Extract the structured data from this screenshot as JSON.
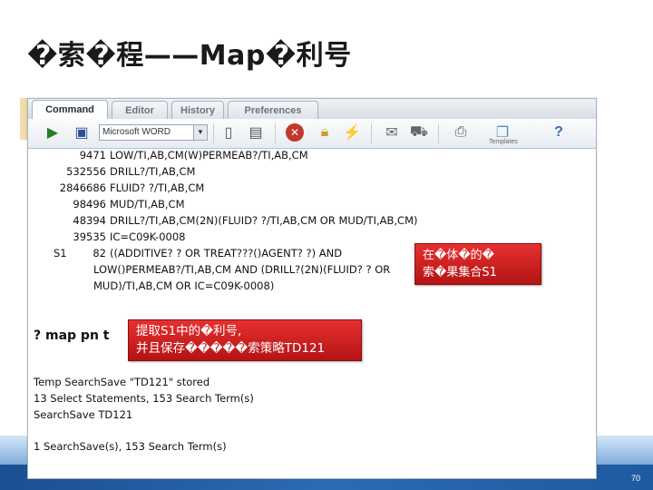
{
  "slide": {
    "title": "�索�程——Map�利号",
    "page_number": "70"
  },
  "tabs": [
    {
      "label": "Command",
      "active": true
    },
    {
      "label": "Editor",
      "active": false
    },
    {
      "label": "History",
      "active": false
    },
    {
      "label": "Preferences",
      "active": false
    }
  ],
  "toolbar": {
    "database_select": "Microsoft WORD",
    "templates_label": "Templates",
    "icons": [
      "run-icon",
      "save-icon",
      "new-document-icon",
      "print-preview-icon",
      "cancel-icon",
      "lock-icon",
      "connect-icon",
      "disconnect-icon",
      "email-icon",
      "cart-icon",
      "printer-icon",
      "templates-icon",
      "help-icon"
    ]
  },
  "search_lines": [
    {
      "count": "9471",
      "query": "LOW/TI,AB,CM(W)PERMEAB?/TI,AB,CM"
    },
    {
      "count": "532556",
      "query": "DRILL?/TI,AB,CM"
    },
    {
      "count": "2846686",
      "query": "FLUID? ?/TI,AB,CM"
    },
    {
      "count": "98496",
      "query": "MUD/TI,AB,CM"
    },
    {
      "count": "48394",
      "query": "DRILL?/TI,AB,CM(2N)(FLUID? ?/TI,AB,CM OR MUD/TI,AB,CM)"
    },
    {
      "count": "39535",
      "query": "IC=C09K-0008"
    }
  ],
  "s1": {
    "set": "S1",
    "count": "82",
    "lines": [
      "((ADDITIVE? ? OR TREAT???()AGENT? ?) AND",
      "LOW()PERMEAB?/TI,AB,CM AND (DRILL?(2N)(FLUID? ? OR",
      "MUD)/TI,AB,CM OR IC=C09K-0008)"
    ]
  },
  "callout_s1": [
    "在�体�的�",
    "索�果集合S1"
  ],
  "command": "? map pn t",
  "callout_map": [
    "提取S1中的�利号,",
    "并且保存�����索策略TD121"
  ],
  "output_lines": [
    "Temp SearchSave \"TD121\" stored",
    "13 Select Statements, 153 Search Term(s)",
    "SearchSave TD121",
    "",
    "1 SearchSave(s),  153 Search Term(s)"
  ],
  "colors": {
    "callout": "#d42222",
    "wave": "#2f6db2"
  }
}
